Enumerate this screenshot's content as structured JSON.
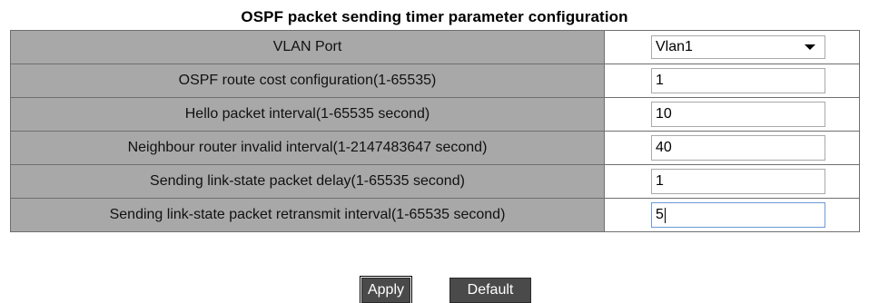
{
  "title": "OSPF packet sending timer parameter configuration",
  "rows": [
    {
      "label": "VLAN Port",
      "value": "Vlan1",
      "type": "select"
    },
    {
      "label": "OSPF route cost configuration(1-65535)",
      "value": "1",
      "type": "text"
    },
    {
      "label": "Hello packet interval(1-65535 second)",
      "value": "10",
      "type": "text"
    },
    {
      "label": "Neighbour router invalid interval(1-2147483647 second)",
      "value": "40",
      "type": "text"
    },
    {
      "label": "Sending link-state packet delay(1-65535 second)",
      "value": "1",
      "type": "text"
    },
    {
      "label": "Sending link-state packet retransmit interval(1-65535 second)",
      "value": "5",
      "type": "text"
    }
  ],
  "buttons": {
    "apply": "Apply",
    "default": "Default"
  },
  "colors": {
    "label_bg": "#a8a8a8",
    "button_bg": "#4a4a4a",
    "focus_border": "#6b9bd8"
  },
  "icons": {
    "select_arrow": "chevron-down-icon"
  }
}
